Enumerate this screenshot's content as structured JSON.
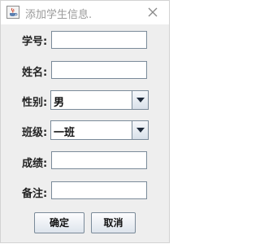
{
  "window": {
    "title": "添加学生信息."
  },
  "form": {
    "id_label": "学号:",
    "id_value": "",
    "name_label": "姓名:",
    "name_value": "",
    "gender_label": "性别:",
    "gender_selected": "男",
    "class_label": "班级:",
    "class_selected": "一班",
    "score_label": "成绩:",
    "score_value": "",
    "remark_label": "备注:",
    "remark_value": ""
  },
  "buttons": {
    "confirm": "确定",
    "cancel": "取消"
  },
  "icons": {
    "app": "java-cup-icon",
    "close": "close-icon",
    "dropdown": "triangle-down-icon"
  },
  "colors": {
    "title_text": "#9a9a9a",
    "field_border": "#7a8a99",
    "panel_bg": "#eeeeee"
  }
}
